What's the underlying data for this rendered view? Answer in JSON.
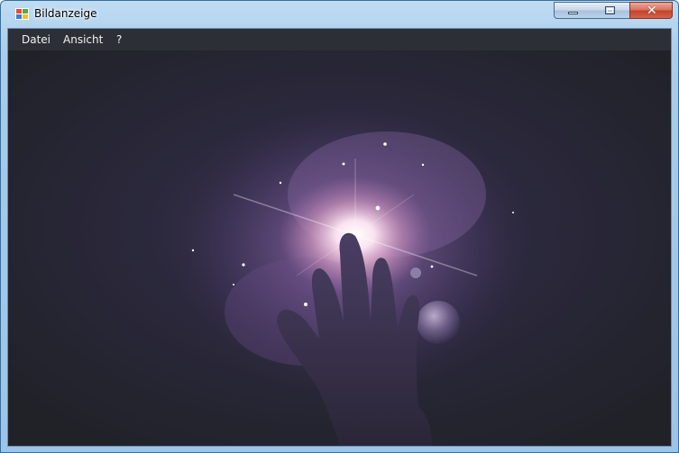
{
  "window": {
    "title": "Bildanzeige",
    "title_icon": "app-window-icon",
    "controls": [
      "minimize-icon",
      "maximize-icon",
      "close-icon"
    ]
  },
  "menu": {
    "items": [
      "Datei",
      "Ansicht",
      "?"
    ]
  },
  "image": {
    "subject": "space-nebula-hand-picture"
  },
  "colors": {
    "menu_background": "#2c2f35",
    "menu_text": "#f2f2f2",
    "frame_blue": "#9cc4e6",
    "close_red": "#c24329"
  }
}
